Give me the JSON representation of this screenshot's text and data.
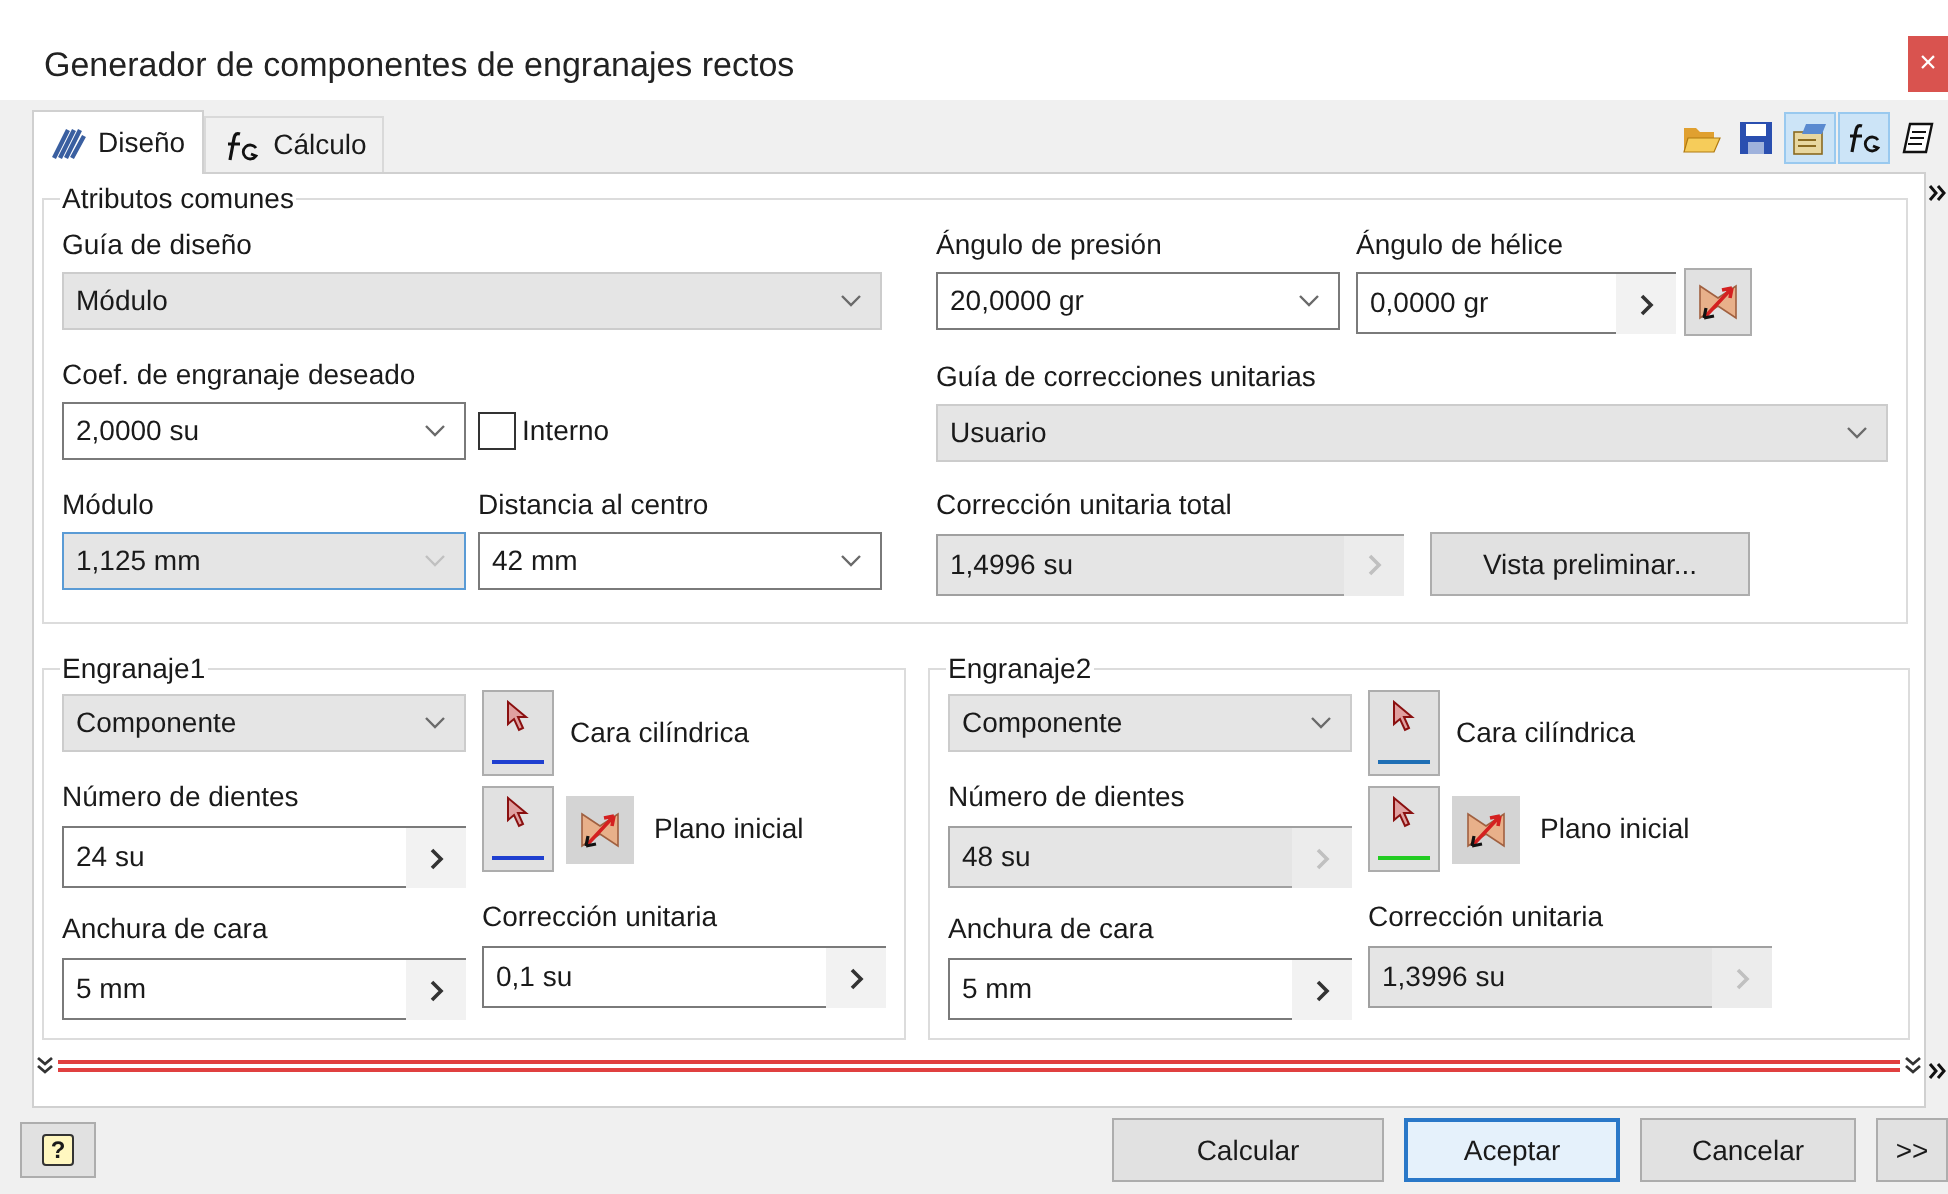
{
  "window": {
    "title": "Generador de componentes de engranajes rectos",
    "close": "×"
  },
  "tabs": [
    {
      "label": "Diseño",
      "kind": "design",
      "selected": true
    },
    {
      "label": "Cálculo",
      "kind": "formula",
      "selected": false
    }
  ],
  "toolbar": [
    {
      "kind": "folder",
      "on": false
    },
    {
      "kind": "save",
      "on": false
    },
    {
      "kind": "properties",
      "on": true
    },
    {
      "kind": "formula",
      "on": true
    },
    {
      "kind": "notes",
      "on": false
    }
  ],
  "common": {
    "title": "Atributos comunes",
    "design_guide": {
      "label": "Guía de diseño",
      "value": "Módulo",
      "kind": "dropdown",
      "disabled": true,
      "focused": false
    },
    "mesh_ratio": {
      "label": "Coef. de engranaje deseado",
      "value": "2,0000 su",
      "kind": "dropdown",
      "disabled": false,
      "focused": false
    },
    "internal": {
      "label": "Interno",
      "checked": false
    },
    "module": {
      "label": "Módulo",
      "value": "1,125 mm",
      "kind": "dropdown",
      "disabled": true,
      "focused": true
    },
    "center_distance": {
      "label": "Distancia al centro",
      "value": "42 mm",
      "kind": "dropdown",
      "disabled": false,
      "focused": false
    },
    "pressure_angle": {
      "label": "Ángulo de presión",
      "value": "20,0000 gr",
      "kind": "dropdown",
      "disabled": false,
      "focused": false
    },
    "helix_angle": {
      "label": "Ángulo de hélice",
      "value": "0,0000 gr",
      "kind": "spin",
      "disabled": false,
      "focused": false
    },
    "correction_guide": {
      "label": "Guía de correcciones unitarias",
      "value": "Usuario",
      "kind": "dropdown",
      "disabled": true,
      "focused": false
    },
    "total_correction": {
      "label": "Corrección unitaria total",
      "value": "1,4996 su",
      "kind": "spin",
      "disabled": true,
      "focused": false
    },
    "preview_button": "Vista preliminar..."
  },
  "gears": [
    {
      "title": "Engranaje1",
      "type": {
        "value": "Componente",
        "kind": "dropdown",
        "disabled": true,
        "focused": false
      },
      "face": {
        "label": "Cara cilíndrica",
        "color": "#1f3fd0"
      },
      "teeth": {
        "label": "Número de dientes",
        "value": "24 su",
        "kind": "spin",
        "disabled": false,
        "focused": false
      },
      "plane": {
        "label": "Plano inicial",
        "color": "#1f3fd0"
      },
      "width": {
        "label": "Anchura de cara",
        "value": "5 mm",
        "kind": "spin",
        "disabled": false,
        "focused": false
      },
      "correction": {
        "label": "Corrección unitaria",
        "value": "0,1 su",
        "kind": "spin",
        "disabled": false,
        "focused": false
      }
    },
    {
      "title": "Engranaje2",
      "type": {
        "value": "Componente",
        "kind": "dropdown",
        "disabled": true,
        "focused": false
      },
      "face": {
        "label": "Cara cilíndrica",
        "color": "#1f6fb5"
      },
      "teeth": {
        "label": "Número de dientes",
        "value": "48 su",
        "kind": "spin",
        "disabled": true,
        "focused": false
      },
      "plane": {
        "label": "Plano inicial",
        "color": "#22cc22"
      },
      "width": {
        "label": "Anchura de cara",
        "value": "5 mm",
        "kind": "spin",
        "disabled": false,
        "focused": false
      },
      "correction": {
        "label": "Corrección unitaria",
        "value": "1,3996 su",
        "kind": "spin",
        "disabled": true,
        "focused": false
      }
    }
  ],
  "help_button": "?",
  "buttons": [
    {
      "label": "Calcular",
      "default": false
    },
    {
      "label": "Aceptar",
      "default": true
    },
    {
      "label": "Cancelar",
      "default": false
    },
    {
      "label": ">>",
      "default": false
    }
  ]
}
